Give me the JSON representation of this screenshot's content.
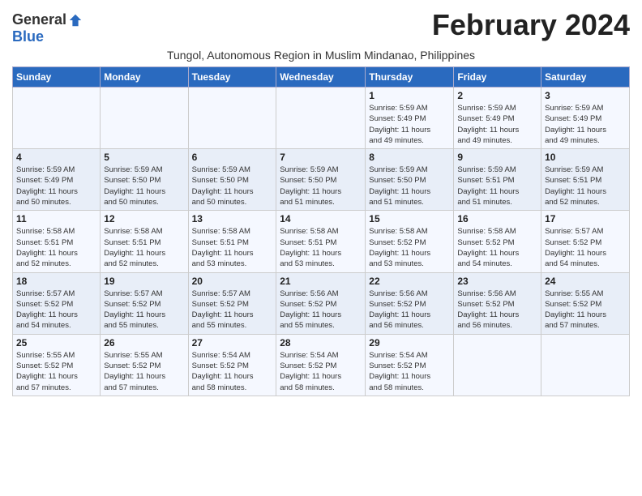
{
  "logo": {
    "general": "General",
    "blue": "Blue"
  },
  "title": "February 2024",
  "location": "Tungol, Autonomous Region in Muslim Mindanao, Philippines",
  "days_of_week": [
    "Sunday",
    "Monday",
    "Tuesday",
    "Wednesday",
    "Thursday",
    "Friday",
    "Saturday"
  ],
  "weeks": [
    [
      {
        "day": "",
        "info": ""
      },
      {
        "day": "",
        "info": ""
      },
      {
        "day": "",
        "info": ""
      },
      {
        "day": "",
        "info": ""
      },
      {
        "day": "1",
        "info": "Sunrise: 5:59 AM\nSunset: 5:49 PM\nDaylight: 11 hours\nand 49 minutes."
      },
      {
        "day": "2",
        "info": "Sunrise: 5:59 AM\nSunset: 5:49 PM\nDaylight: 11 hours\nand 49 minutes."
      },
      {
        "day": "3",
        "info": "Sunrise: 5:59 AM\nSunset: 5:49 PM\nDaylight: 11 hours\nand 49 minutes."
      }
    ],
    [
      {
        "day": "4",
        "info": "Sunrise: 5:59 AM\nSunset: 5:49 PM\nDaylight: 11 hours\nand 50 minutes."
      },
      {
        "day": "5",
        "info": "Sunrise: 5:59 AM\nSunset: 5:50 PM\nDaylight: 11 hours\nand 50 minutes."
      },
      {
        "day": "6",
        "info": "Sunrise: 5:59 AM\nSunset: 5:50 PM\nDaylight: 11 hours\nand 50 minutes."
      },
      {
        "day": "7",
        "info": "Sunrise: 5:59 AM\nSunset: 5:50 PM\nDaylight: 11 hours\nand 51 minutes."
      },
      {
        "day": "8",
        "info": "Sunrise: 5:59 AM\nSunset: 5:50 PM\nDaylight: 11 hours\nand 51 minutes."
      },
      {
        "day": "9",
        "info": "Sunrise: 5:59 AM\nSunset: 5:51 PM\nDaylight: 11 hours\nand 51 minutes."
      },
      {
        "day": "10",
        "info": "Sunrise: 5:59 AM\nSunset: 5:51 PM\nDaylight: 11 hours\nand 52 minutes."
      }
    ],
    [
      {
        "day": "11",
        "info": "Sunrise: 5:58 AM\nSunset: 5:51 PM\nDaylight: 11 hours\nand 52 minutes."
      },
      {
        "day": "12",
        "info": "Sunrise: 5:58 AM\nSunset: 5:51 PM\nDaylight: 11 hours\nand 52 minutes."
      },
      {
        "day": "13",
        "info": "Sunrise: 5:58 AM\nSunset: 5:51 PM\nDaylight: 11 hours\nand 53 minutes."
      },
      {
        "day": "14",
        "info": "Sunrise: 5:58 AM\nSunset: 5:51 PM\nDaylight: 11 hours\nand 53 minutes."
      },
      {
        "day": "15",
        "info": "Sunrise: 5:58 AM\nSunset: 5:52 PM\nDaylight: 11 hours\nand 53 minutes."
      },
      {
        "day": "16",
        "info": "Sunrise: 5:58 AM\nSunset: 5:52 PM\nDaylight: 11 hours\nand 54 minutes."
      },
      {
        "day": "17",
        "info": "Sunrise: 5:57 AM\nSunset: 5:52 PM\nDaylight: 11 hours\nand 54 minutes."
      }
    ],
    [
      {
        "day": "18",
        "info": "Sunrise: 5:57 AM\nSunset: 5:52 PM\nDaylight: 11 hours\nand 54 minutes."
      },
      {
        "day": "19",
        "info": "Sunrise: 5:57 AM\nSunset: 5:52 PM\nDaylight: 11 hours\nand 55 minutes."
      },
      {
        "day": "20",
        "info": "Sunrise: 5:57 AM\nSunset: 5:52 PM\nDaylight: 11 hours\nand 55 minutes."
      },
      {
        "day": "21",
        "info": "Sunrise: 5:56 AM\nSunset: 5:52 PM\nDaylight: 11 hours\nand 55 minutes."
      },
      {
        "day": "22",
        "info": "Sunrise: 5:56 AM\nSunset: 5:52 PM\nDaylight: 11 hours\nand 56 minutes."
      },
      {
        "day": "23",
        "info": "Sunrise: 5:56 AM\nSunset: 5:52 PM\nDaylight: 11 hours\nand 56 minutes."
      },
      {
        "day": "24",
        "info": "Sunrise: 5:55 AM\nSunset: 5:52 PM\nDaylight: 11 hours\nand 57 minutes."
      }
    ],
    [
      {
        "day": "25",
        "info": "Sunrise: 5:55 AM\nSunset: 5:52 PM\nDaylight: 11 hours\nand 57 minutes."
      },
      {
        "day": "26",
        "info": "Sunrise: 5:55 AM\nSunset: 5:52 PM\nDaylight: 11 hours\nand 57 minutes."
      },
      {
        "day": "27",
        "info": "Sunrise: 5:54 AM\nSunset: 5:52 PM\nDaylight: 11 hours\nand 58 minutes."
      },
      {
        "day": "28",
        "info": "Sunrise: 5:54 AM\nSunset: 5:52 PM\nDaylight: 11 hours\nand 58 minutes."
      },
      {
        "day": "29",
        "info": "Sunrise: 5:54 AM\nSunset: 5:52 PM\nDaylight: 11 hours\nand 58 minutes."
      },
      {
        "day": "",
        "info": ""
      },
      {
        "day": "",
        "info": ""
      }
    ]
  ]
}
